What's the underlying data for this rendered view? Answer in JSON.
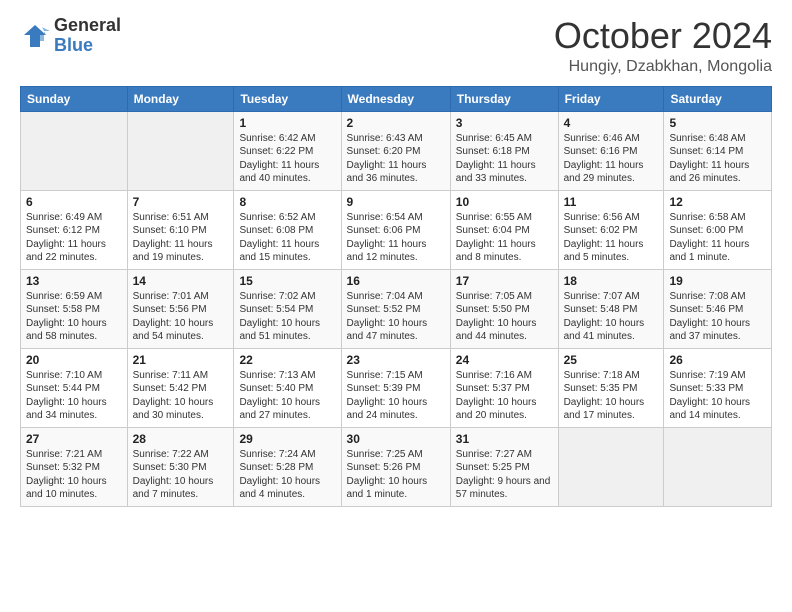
{
  "logo": {
    "general": "General",
    "blue": "Blue"
  },
  "header": {
    "month": "October 2024",
    "location": "Hungiy, Dzabkhan, Mongolia"
  },
  "weekdays": [
    "Sunday",
    "Monday",
    "Tuesday",
    "Wednesday",
    "Thursday",
    "Friday",
    "Saturday"
  ],
  "weeks": [
    [
      {
        "day": "",
        "info": ""
      },
      {
        "day": "",
        "info": ""
      },
      {
        "day": "1",
        "info": "Sunrise: 6:42 AM\nSunset: 6:22 PM\nDaylight: 11 hours and 40 minutes."
      },
      {
        "day": "2",
        "info": "Sunrise: 6:43 AM\nSunset: 6:20 PM\nDaylight: 11 hours and 36 minutes."
      },
      {
        "day": "3",
        "info": "Sunrise: 6:45 AM\nSunset: 6:18 PM\nDaylight: 11 hours and 33 minutes."
      },
      {
        "day": "4",
        "info": "Sunrise: 6:46 AM\nSunset: 6:16 PM\nDaylight: 11 hours and 29 minutes."
      },
      {
        "day": "5",
        "info": "Sunrise: 6:48 AM\nSunset: 6:14 PM\nDaylight: 11 hours and 26 minutes."
      }
    ],
    [
      {
        "day": "6",
        "info": "Sunrise: 6:49 AM\nSunset: 6:12 PM\nDaylight: 11 hours and 22 minutes."
      },
      {
        "day": "7",
        "info": "Sunrise: 6:51 AM\nSunset: 6:10 PM\nDaylight: 11 hours and 19 minutes."
      },
      {
        "day": "8",
        "info": "Sunrise: 6:52 AM\nSunset: 6:08 PM\nDaylight: 11 hours and 15 minutes."
      },
      {
        "day": "9",
        "info": "Sunrise: 6:54 AM\nSunset: 6:06 PM\nDaylight: 11 hours and 12 minutes."
      },
      {
        "day": "10",
        "info": "Sunrise: 6:55 AM\nSunset: 6:04 PM\nDaylight: 11 hours and 8 minutes."
      },
      {
        "day": "11",
        "info": "Sunrise: 6:56 AM\nSunset: 6:02 PM\nDaylight: 11 hours and 5 minutes."
      },
      {
        "day": "12",
        "info": "Sunrise: 6:58 AM\nSunset: 6:00 PM\nDaylight: 11 hours and 1 minute."
      }
    ],
    [
      {
        "day": "13",
        "info": "Sunrise: 6:59 AM\nSunset: 5:58 PM\nDaylight: 10 hours and 58 minutes."
      },
      {
        "day": "14",
        "info": "Sunrise: 7:01 AM\nSunset: 5:56 PM\nDaylight: 10 hours and 54 minutes."
      },
      {
        "day": "15",
        "info": "Sunrise: 7:02 AM\nSunset: 5:54 PM\nDaylight: 10 hours and 51 minutes."
      },
      {
        "day": "16",
        "info": "Sunrise: 7:04 AM\nSunset: 5:52 PM\nDaylight: 10 hours and 47 minutes."
      },
      {
        "day": "17",
        "info": "Sunrise: 7:05 AM\nSunset: 5:50 PM\nDaylight: 10 hours and 44 minutes."
      },
      {
        "day": "18",
        "info": "Sunrise: 7:07 AM\nSunset: 5:48 PM\nDaylight: 10 hours and 41 minutes."
      },
      {
        "day": "19",
        "info": "Sunrise: 7:08 AM\nSunset: 5:46 PM\nDaylight: 10 hours and 37 minutes."
      }
    ],
    [
      {
        "day": "20",
        "info": "Sunrise: 7:10 AM\nSunset: 5:44 PM\nDaylight: 10 hours and 34 minutes."
      },
      {
        "day": "21",
        "info": "Sunrise: 7:11 AM\nSunset: 5:42 PM\nDaylight: 10 hours and 30 minutes."
      },
      {
        "day": "22",
        "info": "Sunrise: 7:13 AM\nSunset: 5:40 PM\nDaylight: 10 hours and 27 minutes."
      },
      {
        "day": "23",
        "info": "Sunrise: 7:15 AM\nSunset: 5:39 PM\nDaylight: 10 hours and 24 minutes."
      },
      {
        "day": "24",
        "info": "Sunrise: 7:16 AM\nSunset: 5:37 PM\nDaylight: 10 hours and 20 minutes."
      },
      {
        "day": "25",
        "info": "Sunrise: 7:18 AM\nSunset: 5:35 PM\nDaylight: 10 hours and 17 minutes."
      },
      {
        "day": "26",
        "info": "Sunrise: 7:19 AM\nSunset: 5:33 PM\nDaylight: 10 hours and 14 minutes."
      }
    ],
    [
      {
        "day": "27",
        "info": "Sunrise: 7:21 AM\nSunset: 5:32 PM\nDaylight: 10 hours and 10 minutes."
      },
      {
        "day": "28",
        "info": "Sunrise: 7:22 AM\nSunset: 5:30 PM\nDaylight: 10 hours and 7 minutes."
      },
      {
        "day": "29",
        "info": "Sunrise: 7:24 AM\nSunset: 5:28 PM\nDaylight: 10 hours and 4 minutes."
      },
      {
        "day": "30",
        "info": "Sunrise: 7:25 AM\nSunset: 5:26 PM\nDaylight: 10 hours and 1 minute."
      },
      {
        "day": "31",
        "info": "Sunrise: 7:27 AM\nSunset: 5:25 PM\nDaylight: 9 hours and 57 minutes."
      },
      {
        "day": "",
        "info": ""
      },
      {
        "day": "",
        "info": ""
      }
    ]
  ]
}
